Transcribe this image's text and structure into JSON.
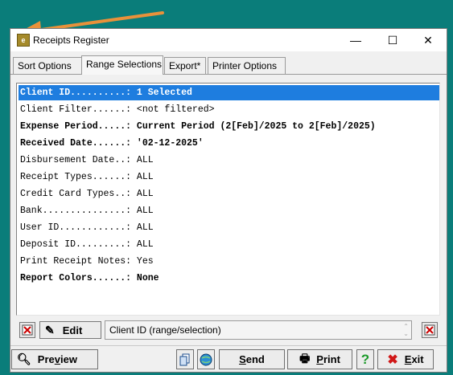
{
  "window": {
    "title": "Receipts Register",
    "app_icon_text": "e",
    "controls": {
      "minimize": "—",
      "maximize": "☐",
      "close": "✕"
    }
  },
  "tabs": [
    {
      "label": "Sort Options",
      "active": false
    },
    {
      "label": "Range Selections",
      "active": true
    },
    {
      "label": "Export*",
      "active": false
    },
    {
      "label": "Printer Options",
      "active": false
    }
  ],
  "selections": [
    {
      "text": "Client ID..........: 1 Selected",
      "selected": true,
      "bold": true
    },
    {
      "text": "Client Filter......: <not filtered>",
      "selected": false,
      "bold": false
    },
    {
      "text": "Expense Period.....: Current Period (2[Feb]/2025 to 2[Feb]/2025)",
      "selected": false,
      "bold": true
    },
    {
      "text": "Received Date......: '02-12-2025'",
      "selected": false,
      "bold": true
    },
    {
      "text": "Disbursement Date..: ALL",
      "selected": false,
      "bold": false
    },
    {
      "text": "Receipt Types......: ALL",
      "selected": false,
      "bold": false
    },
    {
      "text": "Credit Card Types..: ALL",
      "selected": false,
      "bold": false
    },
    {
      "text": "Bank...............: ALL",
      "selected": false,
      "bold": false
    },
    {
      "text": "User ID............: ALL",
      "selected": false,
      "bold": false
    },
    {
      "text": "Deposit ID.........: ALL",
      "selected": false,
      "bold": false
    },
    {
      "text": "Print Receipt Notes: Yes",
      "selected": false,
      "bold": false
    },
    {
      "text": "Report Colors......: None",
      "selected": false,
      "bold": true
    }
  ],
  "bottom": {
    "edit_label": "Edit",
    "status_text": "Client ID (range/selection)"
  },
  "footer": {
    "preview": {
      "pre": "Pre",
      "u": "v",
      "post": "iew"
    },
    "send": {
      "pre": "",
      "u": "S",
      "post": "end"
    },
    "print": {
      "pre": "",
      "u": "P",
      "post": "rint"
    },
    "help": "?",
    "exit": {
      "pre": "",
      "u": "E",
      "post": "xit"
    }
  },
  "colors": {
    "desktop": "#0a7d7a",
    "selection": "#1e7ddf",
    "arrow": "#e8913a"
  }
}
